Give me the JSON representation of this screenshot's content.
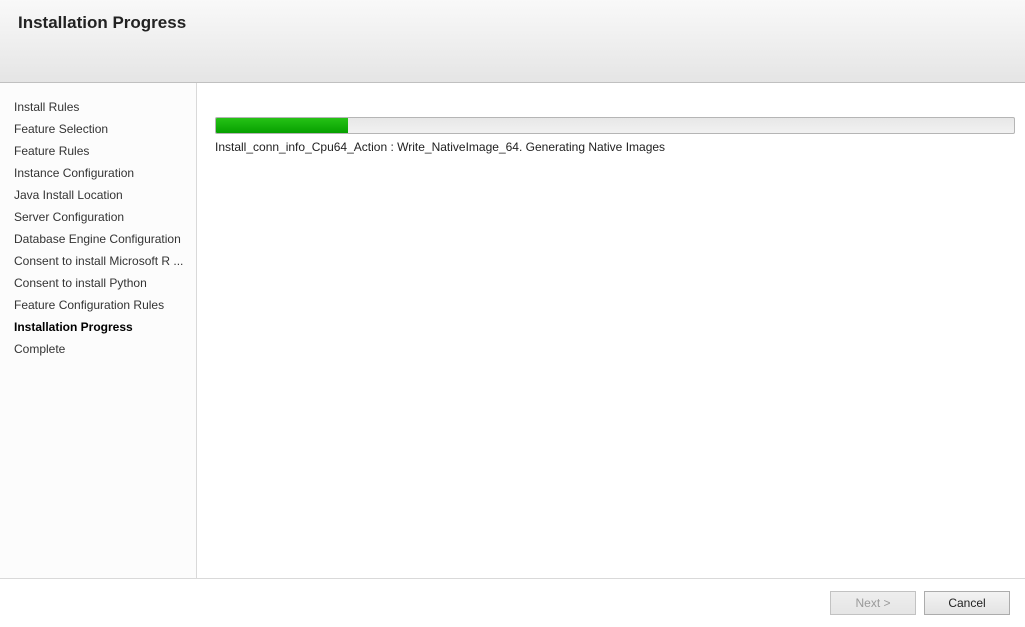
{
  "header": {
    "title": "Installation Progress"
  },
  "sidebar": {
    "items": [
      {
        "label": "Install Rules",
        "current": false
      },
      {
        "label": "Feature Selection",
        "current": false
      },
      {
        "label": "Feature Rules",
        "current": false
      },
      {
        "label": "Instance Configuration",
        "current": false
      },
      {
        "label": "Java Install Location",
        "current": false
      },
      {
        "label": "Server Configuration",
        "current": false
      },
      {
        "label": "Database Engine Configuration",
        "current": false
      },
      {
        "label": "Consent to install Microsoft R ...",
        "current": false
      },
      {
        "label": "Consent to install Python",
        "current": false
      },
      {
        "label": "Feature Configuration Rules",
        "current": false
      },
      {
        "label": "Installation Progress",
        "current": true
      },
      {
        "label": "Complete",
        "current": false
      }
    ]
  },
  "main": {
    "progress_percent": 16.5,
    "status_text": "Install_conn_info_Cpu64_Action : Write_NativeImage_64. Generating Native Images"
  },
  "footer": {
    "next_label": "Next >",
    "next_enabled": false,
    "cancel_label": "Cancel"
  },
  "colors": {
    "progress_fill": "#06a000"
  }
}
